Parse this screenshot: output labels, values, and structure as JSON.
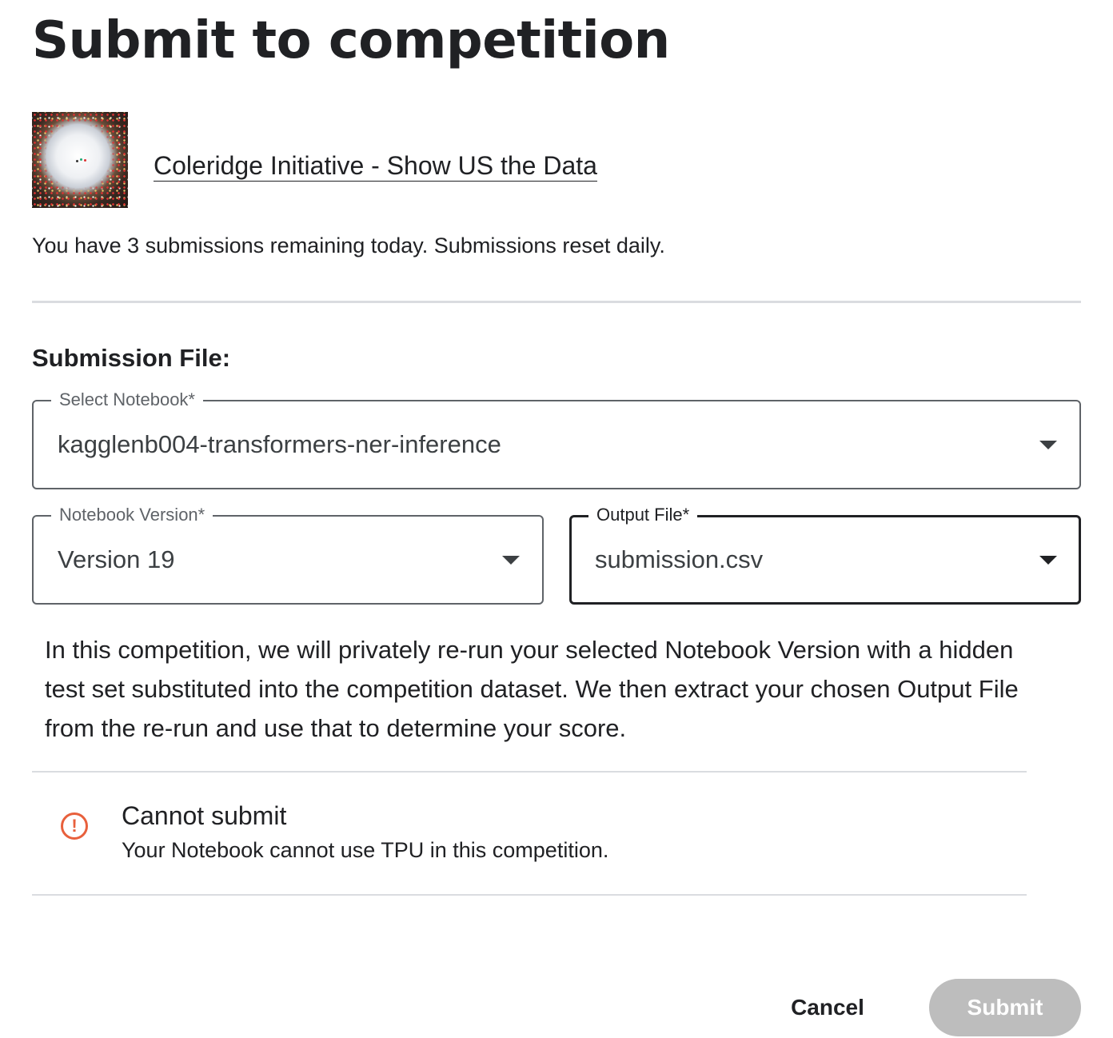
{
  "dialog": {
    "title": "Submit to competition"
  },
  "competition": {
    "name": "Coleridge Initiative - Show US the Data",
    "remaining_text": "You have 3 submissions remaining today. Submissions reset daily."
  },
  "submission": {
    "section_label": "Submission File:",
    "notebook": {
      "label": "Select Notebook*",
      "value": "kagglenb004-transformers-ner-inference"
    },
    "version": {
      "label": "Notebook Version*",
      "value": "Version 19"
    },
    "output": {
      "label": "Output File*",
      "value": "submission.csv"
    },
    "explanation": "In this competition, we will privately re-run your selected Notebook Version with a hidden test set substituted into the competition dataset. We then extract your chosen Output File from the re-run and use that to determine your score."
  },
  "alert": {
    "icon": "alert-circle-icon",
    "icon_glyph": "!",
    "color": "#e8603c",
    "title": "Cannot submit",
    "message": "Your Notebook cannot use TPU in this competition."
  },
  "actions": {
    "cancel_label": "Cancel",
    "submit_label": "Submit",
    "submit_disabled": true
  }
}
